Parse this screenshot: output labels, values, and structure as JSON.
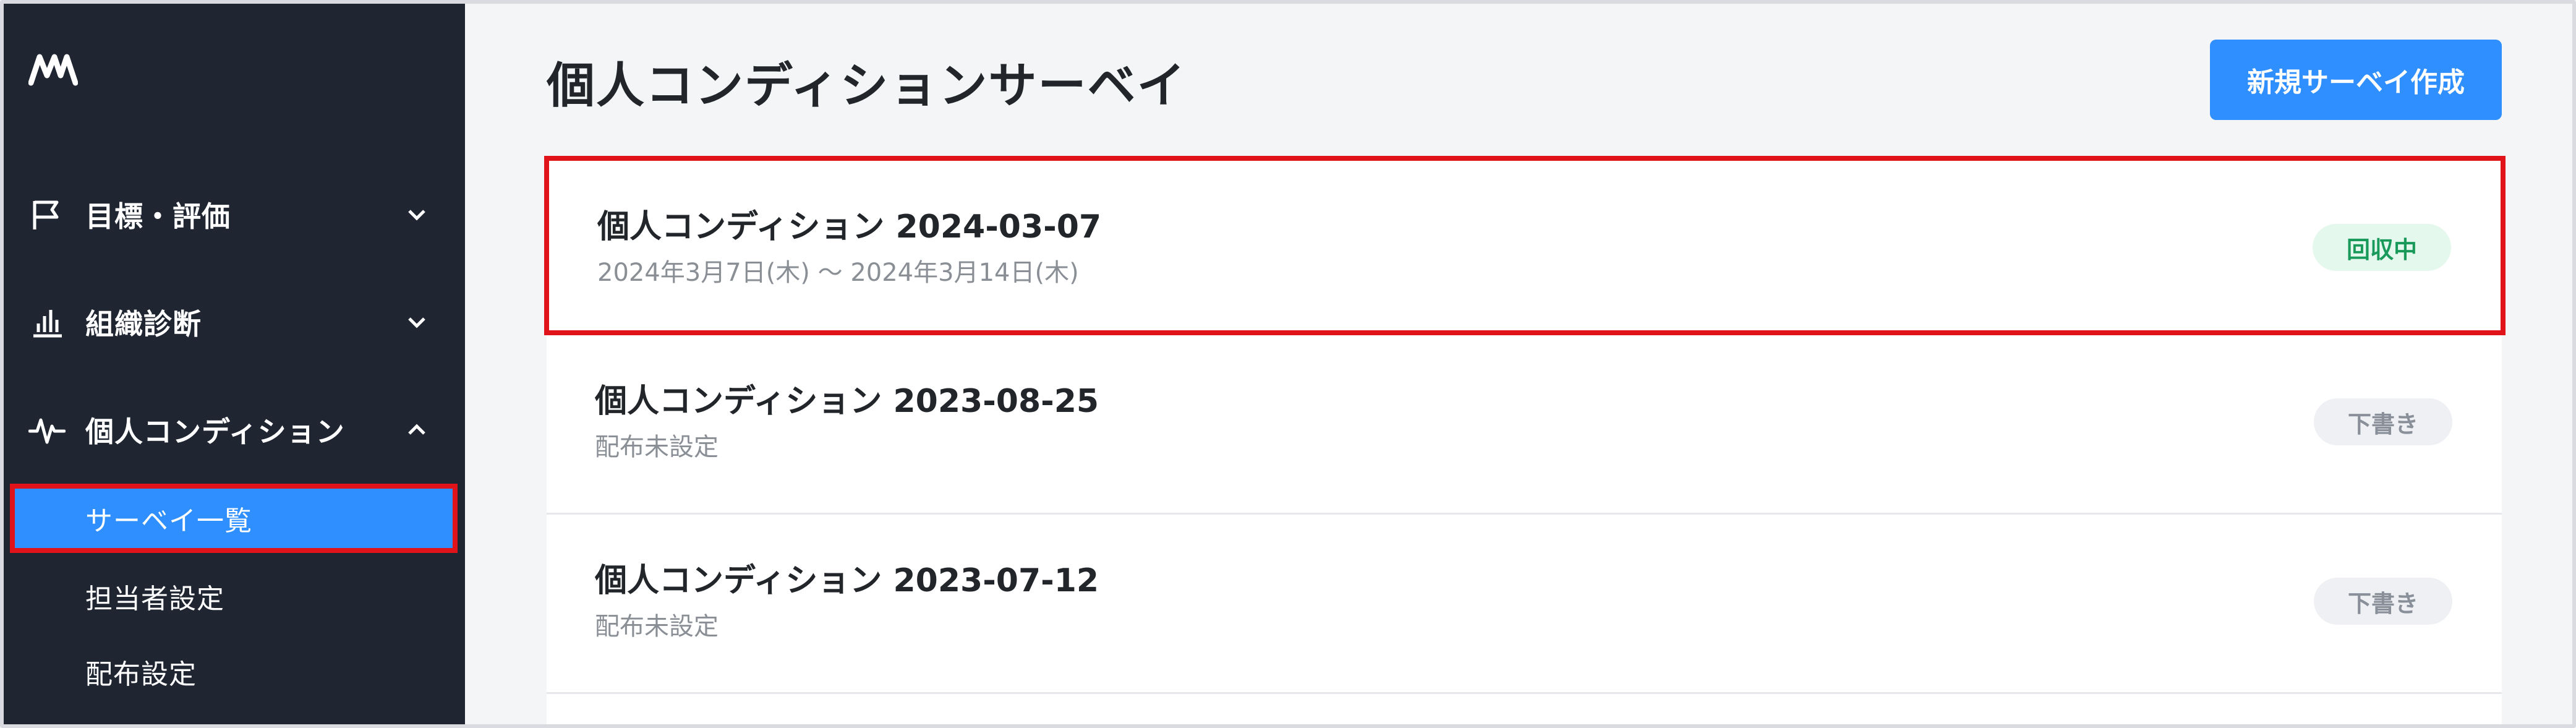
{
  "sidebar": {
    "nav": [
      {
        "label": "目標・評価",
        "icon": "flag-icon",
        "chevron": "chevron-down-icon"
      },
      {
        "label": "組織診断",
        "icon": "bar-chart-icon",
        "chevron": "chevron-down-icon"
      },
      {
        "label": "個人コンディション",
        "icon": "pulse-icon",
        "chevron": "chevron-up-icon"
      }
    ],
    "sub_items": [
      {
        "label": "サーベイ一覧",
        "active": true
      },
      {
        "label": "担当者設定",
        "active": false
      },
      {
        "label": "配布設定",
        "active": false
      }
    ]
  },
  "main": {
    "title": "個人コンディションサーベイ",
    "new_button": "新規サーベイ作成",
    "surveys": [
      {
        "title": "個人コンディション 2024-03-07",
        "subtitle": "2024年3月7日(木) 〜 2024年3月14日(木)",
        "status": "回収中"
      },
      {
        "title": "個人コンディション 2023-08-25",
        "subtitle": "配布未設定",
        "status": "下書き"
      },
      {
        "title": "個人コンディション 2023-07-12",
        "subtitle": "配布未設定",
        "status": "下書き"
      }
    ]
  },
  "colors": {
    "sidebar_bg": "#1f2631",
    "accent": "#2f8fff",
    "highlight": "#e0131a",
    "status_active": "#1a9a5a",
    "status_draft": "#8a9099"
  }
}
